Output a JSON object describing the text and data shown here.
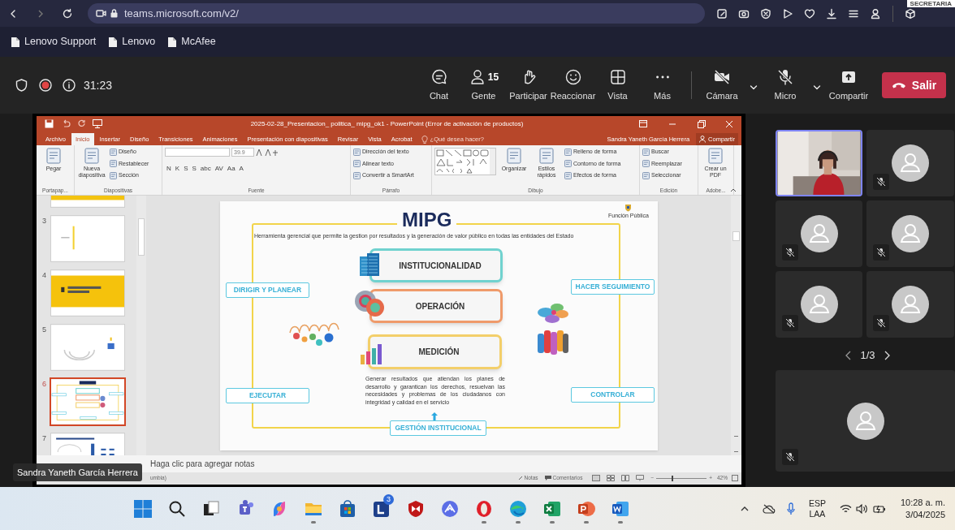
{
  "corner_text": "SECRETARIA",
  "browser": {
    "url": "teams.microsoft.com/v2/",
    "bookmarks": [
      "Lenovo Support",
      "Lenovo",
      "McAfee"
    ]
  },
  "meeting_bar": {
    "timer": "31:23",
    "recording": true,
    "controls": [
      {
        "kind": "chat",
        "label": "Chat"
      },
      {
        "kind": "people",
        "label": "Gente",
        "count": "15"
      },
      {
        "kind": "raise",
        "label": "Participar"
      },
      {
        "kind": "react",
        "label": "Reaccionar"
      },
      {
        "kind": "view",
        "label": "Vista"
      },
      {
        "kind": "more",
        "label": "Más"
      }
    ],
    "devices": [
      {
        "kind": "camera",
        "label": "Cámara",
        "on": false
      },
      {
        "kind": "mic",
        "label": "Micro",
        "on": false
      },
      {
        "kind": "share",
        "label": "Compartir"
      }
    ],
    "leave": "Salir"
  },
  "powerpoint": {
    "title": "2025-02-28_Presentacion_ politica_ mipg_ok1 - PowerPoint (Error de activación de productos)",
    "tabs": [
      {
        "label": "Archivo",
        "selected": false
      },
      {
        "label": "Inicio",
        "selected": true
      },
      {
        "label": "Insertar",
        "selected": false
      },
      {
        "label": "Diseño",
        "selected": false
      },
      {
        "label": "Transiciones",
        "selected": false
      },
      {
        "label": "Animaciones",
        "selected": false
      },
      {
        "label": "Presentación con diapositivas",
        "selected": false
      },
      {
        "label": "Revisar",
        "selected": false
      },
      {
        "label": "Vista",
        "selected": false
      },
      {
        "label": "Acrobat",
        "selected": false
      }
    ],
    "search_hint": "¿Qué desea hacer?",
    "user": "Sandra Yaneth García Herrera",
    "share": "Compartir",
    "ribbon_groups": [
      {
        "label": "Portapap...",
        "items": [
          {
            "kind": "large",
            "label": "Pegar"
          }
        ]
      },
      {
        "label": "Diapositivas",
        "items": [
          {
            "kind": "large",
            "label": "Nueva diapositiva"
          },
          {
            "kind": "small",
            "label": "Diseño"
          },
          {
            "kind": "small",
            "label": "Restablecer"
          },
          {
            "kind": "small",
            "label": "Sección"
          }
        ]
      },
      {
        "label": "Fuente",
        "items": [
          {
            "kind": "field",
            "value": "39.9"
          },
          {
            "kind": "buttons",
            "labels": [
              "N",
              "K",
              "S",
              "S",
              "abc",
              "AV",
              "Aa",
              "A"
            ]
          }
        ]
      },
      {
        "label": "Párrafo",
        "items": [
          {
            "kind": "small",
            "label": "Dirección del texto"
          },
          {
            "kind": "small",
            "label": "Alinear texto"
          },
          {
            "kind": "small",
            "label": "Convertir a SmartArt"
          }
        ]
      },
      {
        "label": "Dibujo",
        "items": [
          {
            "kind": "gallery"
          },
          {
            "kind": "large",
            "label": "Organizar"
          },
          {
            "kind": "large",
            "label": "Estilos rápidos"
          },
          {
            "kind": "small",
            "label": "Relleno de forma"
          },
          {
            "kind": "small",
            "label": "Contorno de forma"
          },
          {
            "kind": "small",
            "label": "Efectos de forma"
          }
        ]
      },
      {
        "label": "Edición",
        "items": [
          {
            "kind": "small",
            "label": "Buscar"
          },
          {
            "kind": "small",
            "label": "Reemplazar"
          },
          {
            "kind": "small",
            "label": "Seleccionar"
          }
        ]
      },
      {
        "label": "Adobe...",
        "items": [
          {
            "kind": "large",
            "label": "Crear un PDF"
          }
        ]
      }
    ],
    "thumbnails": [
      {
        "kind": "band",
        "selected": false
      },
      {
        "number": "3",
        "kind": "line",
        "selected": false
      },
      {
        "number": "4",
        "kind": "yellow",
        "selected": false
      },
      {
        "number": "5",
        "kind": "arcs",
        "selected": false
      },
      {
        "number": "6",
        "kind": "diagram",
        "selected": true
      },
      {
        "number": "7",
        "kind": "chart",
        "selected": false
      }
    ],
    "slide": {
      "title": "MIPG",
      "logo_text": "Función Pública",
      "subtitle": "Herramienta gerencial que permite la gestion por resultados y la generación de valor público en todas las entidades del Estado",
      "pillars": [
        {
          "label": "INSTITUCIONALIDAD",
          "color": "#70d2cf"
        },
        {
          "label": "OPERACIÓN",
          "color": "#ef9a6a"
        },
        {
          "label": "MEDICIÓN",
          "color": "#f3cf6a"
        }
      ],
      "actions": [
        {
          "label": "DIRIGIR Y PLANEAR"
        },
        {
          "label": "HACER SEGUIMIENTO"
        },
        {
          "label": "EJECUTAR"
        },
        {
          "label": "CONTROLAR"
        }
      ],
      "description": "Generar resultados que atiendan los planes de desarrollo y garantican los derechos, resuelvan las necesidades  y problemas de los ciudadanos  con integridad y calidad en el servicio",
      "footer": "GESTIÓN INSTITUCIONAL"
    },
    "notes_placeholder": "Haga clic para agregar notas",
    "status": {
      "language": "umbia)",
      "notes": "Notas",
      "comments": "Comentarios",
      "zoom_out": "−",
      "zoom_in": "+",
      "zoom": "42%",
      "level": 0.32
    }
  },
  "presenter_name": "Sandra Yaneth García Herrera",
  "participants": [
    {
      "kind": "video",
      "speaking": true,
      "muted": false
    },
    {
      "kind": "avatar",
      "speaking": false,
      "muted": true
    },
    {
      "kind": "avatar",
      "speaking": false,
      "muted": true
    },
    {
      "kind": "avatar",
      "speaking": false,
      "muted": true
    },
    {
      "kind": "avatar",
      "speaking": false,
      "muted": true
    },
    {
      "kind": "avatar",
      "speaking": false,
      "muted": true
    }
  ],
  "pager": "1/3",
  "featured_participant": {
    "kind": "avatar",
    "speaking": false,
    "muted": true
  },
  "taskbar": {
    "apps": [
      {
        "kind": "start",
        "running": false
      },
      {
        "kind": "search",
        "running": false
      },
      {
        "kind": "taskview",
        "running": false
      },
      {
        "kind": "teams",
        "running": false
      },
      {
        "kind": "copilot",
        "running": false
      },
      {
        "kind": "explorer",
        "running": true
      },
      {
        "kind": "store",
        "running": false
      },
      {
        "kind": "lapp",
        "running": false,
        "badge": "3"
      },
      {
        "kind": "mcafee",
        "running": false
      },
      {
        "kind": "arc",
        "running": false
      },
      {
        "kind": "opera",
        "running": true
      },
      {
        "kind": "edge",
        "running": true
      },
      {
        "kind": "excel",
        "running": true
      },
      {
        "kind": "powerpoint",
        "running": true
      },
      {
        "kind": "word",
        "running": true
      }
    ],
    "language": "ESP",
    "layout": "LAA",
    "time": "10:28 a. m.",
    "date": "3/04/2025"
  }
}
